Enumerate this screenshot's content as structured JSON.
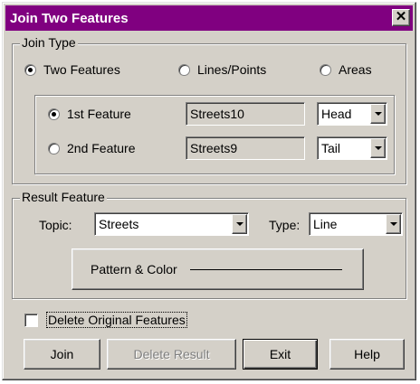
{
  "window": {
    "title": "Join Two Features",
    "close_label": "✕"
  },
  "join_type": {
    "legend": "Join Type",
    "options": [
      "Two Features",
      "Lines/Points",
      "Areas"
    ],
    "selected": "Two Features",
    "first": {
      "label": "1st Feature",
      "value": "Streets10",
      "end": "Head"
    },
    "second": {
      "label": "2nd Feature",
      "value": "Streets9",
      "end": "Tail"
    },
    "selected_feature": "1st Feature"
  },
  "result": {
    "legend": "Result Feature",
    "topic_label": "Topic:",
    "topic_value": "Streets",
    "type_label": "Type:",
    "type_value": "Line",
    "pattern_button": "Pattern & Color"
  },
  "delete_original": {
    "label": "Delete Original Features",
    "checked": false
  },
  "buttons": {
    "join": "Join",
    "delete_result": "Delete Result",
    "exit": "Exit",
    "help": "Help"
  },
  "colors": {
    "titlebar": "#800080",
    "face": "#d4d0c8"
  }
}
